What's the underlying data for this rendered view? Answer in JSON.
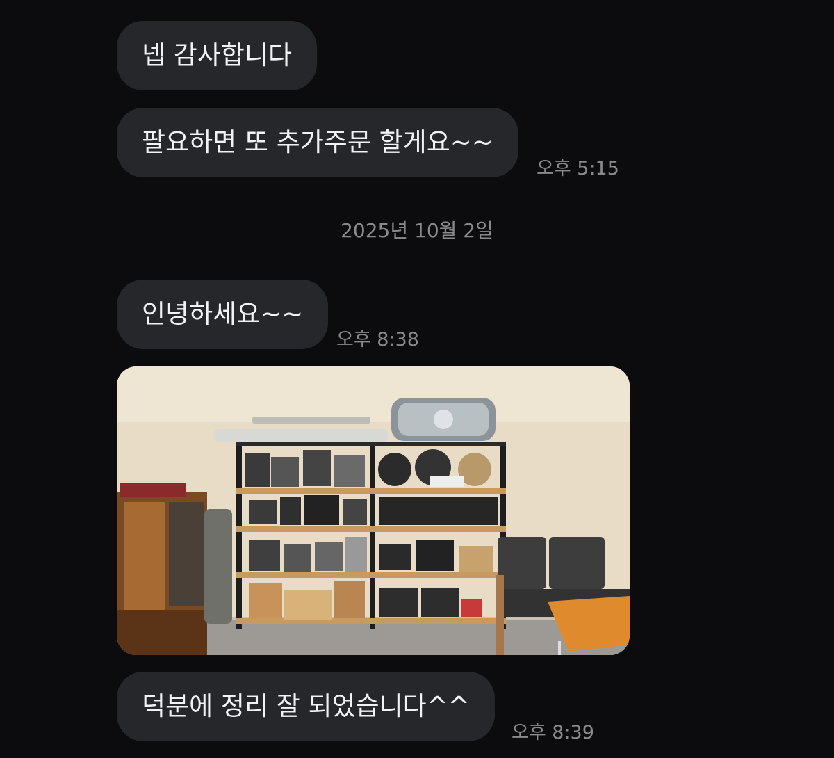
{
  "messages": [
    {
      "text": "넵 감사합니다"
    },
    {
      "text": "팔요하면 또 추가주문 할게요~~",
      "time": "오후 5:15"
    },
    {
      "text": "인녕하세요~~",
      "time": "오후 8:38"
    },
    {
      "text": "덕분에 정리 잘 되었습니다^^",
      "time": "오후 8:39"
    }
  ],
  "date_separator": "2025년 10월 2일",
  "photo": {
    "description_icon": "image-icon"
  }
}
